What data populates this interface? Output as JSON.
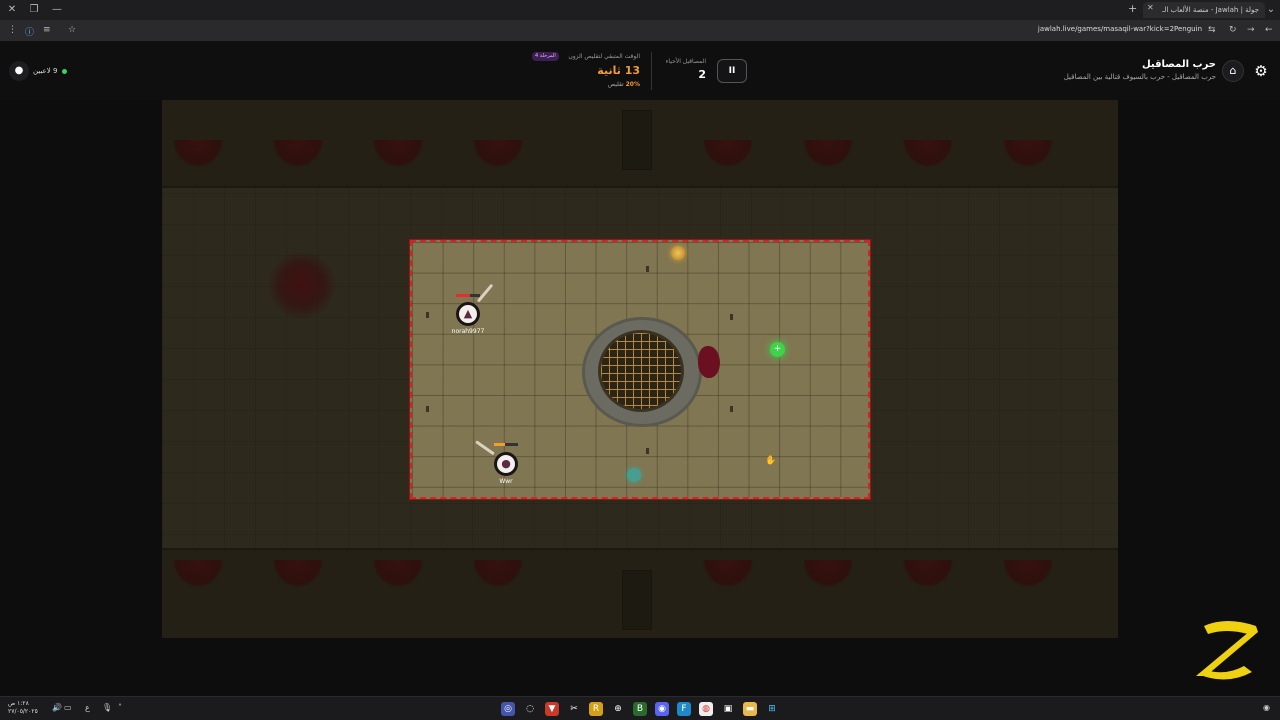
{
  "browser": {
    "tab_title": "جولة | Jawlah - منصة الألعاب الـ",
    "url": "jawlah.live/games/masaqil-war?kick=2Penguin"
  },
  "header": {
    "title": "حرب المصاقيل",
    "subtitle": "حرب المصاقيل - حرب بالسيوف قتالية بين المصاقيل",
    "alive_label": "المصاقيل الأحياء",
    "alive_count": "2",
    "pause_label": "II",
    "timer_label": "الوقت المتبقي لتقليص الزون",
    "stage_badge": "المرحلة 4",
    "timer_value": "13 ثانية",
    "shrink_percent": "20%",
    "shrink_label": "تقليص",
    "players_online": "9 لاعبين",
    "accent_color": "#f39c34",
    "zone_color": "#d42424"
  },
  "players": [
    {
      "name": "norah9977",
      "hp": 0.6,
      "hp_color": "#e03030"
    },
    {
      "name": "Wwr",
      "hp": 0.45,
      "hp_color": "#f39c34"
    }
  ],
  "icons": {
    "settings": "gear-icon",
    "home": "home-icon",
    "pause": "pause-icon",
    "logo": "app-logo-icon"
  },
  "taskbar": {
    "time": "١:٢٨ ص",
    "date": "٢٧/٠٥/٢٠٢٥",
    "lang": "ع"
  }
}
